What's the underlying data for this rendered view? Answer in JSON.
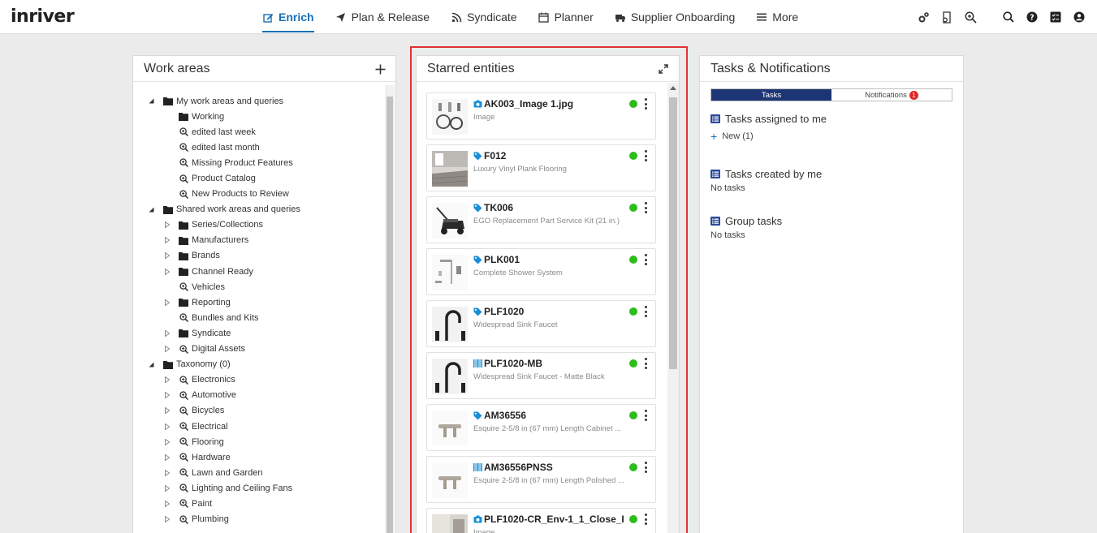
{
  "app": {
    "logo": "inriver"
  },
  "nav": [
    {
      "label": "Enrich",
      "icon": "edit-icon",
      "active": true
    },
    {
      "label": "Plan & Release",
      "icon": "paper-plane-icon",
      "active": false
    },
    {
      "label": "Syndicate",
      "icon": "rss-icon",
      "active": false
    },
    {
      "label": "Planner",
      "icon": "calendar-icon",
      "active": false
    },
    {
      "label": "Supplier Onboarding",
      "icon": "truck-icon",
      "active": false
    },
    {
      "label": "More",
      "icon": "hamburger-icon",
      "active": false
    }
  ],
  "toolbar_icons": [
    "settings-gears-icon",
    "workspace-icon",
    "zoom-in-icon",
    "search-icon",
    "help-icon",
    "checklist-icon",
    "user-icon"
  ],
  "work_areas": {
    "title": "Work areas",
    "items": [
      {
        "label": "My work areas and queries",
        "level": 0,
        "kind": "folder",
        "state": "expanded"
      },
      {
        "label": "Working",
        "level": 1,
        "kind": "folder",
        "state": "none"
      },
      {
        "label": "edited last week",
        "level": 1,
        "kind": "query",
        "state": "none"
      },
      {
        "label": "edited last month",
        "level": 1,
        "kind": "query",
        "state": "none"
      },
      {
        "label": "Missing Product Features",
        "level": 1,
        "kind": "query",
        "state": "none"
      },
      {
        "label": "Product Catalog",
        "level": 1,
        "kind": "query",
        "state": "none"
      },
      {
        "label": "New Products to Review",
        "level": 1,
        "kind": "query",
        "state": "none"
      },
      {
        "label": "Shared work areas and queries",
        "level": 0,
        "kind": "folder",
        "state": "expanded"
      },
      {
        "label": "Series/Collections",
        "level": 1,
        "kind": "folder",
        "state": "collapsed"
      },
      {
        "label": "Manufacturers",
        "level": 1,
        "kind": "folder",
        "state": "collapsed"
      },
      {
        "label": "Brands",
        "level": 1,
        "kind": "folder",
        "state": "collapsed"
      },
      {
        "label": "Channel Ready",
        "level": 1,
        "kind": "folder",
        "state": "collapsed"
      },
      {
        "label": "Vehicles",
        "level": 1,
        "kind": "query",
        "state": "none"
      },
      {
        "label": "Reporting",
        "level": 1,
        "kind": "folder",
        "state": "collapsed"
      },
      {
        "label": "Bundles and Kits",
        "level": 1,
        "kind": "query",
        "state": "none"
      },
      {
        "label": "Syndicate",
        "level": 1,
        "kind": "folder",
        "state": "collapsed"
      },
      {
        "label": "Digital Assets",
        "level": 1,
        "kind": "query",
        "state": "collapsed"
      },
      {
        "label": "Taxonomy (0)",
        "level": 0,
        "kind": "folder",
        "state": "expanded"
      },
      {
        "label": "Electronics",
        "level": 1,
        "kind": "query",
        "state": "collapsed"
      },
      {
        "label": "Automotive",
        "level": 1,
        "kind": "query",
        "state": "collapsed"
      },
      {
        "label": "Bicycles",
        "level": 1,
        "kind": "query",
        "state": "collapsed"
      },
      {
        "label": "Electrical",
        "level": 1,
        "kind": "query",
        "state": "collapsed"
      },
      {
        "label": "Flooring",
        "level": 1,
        "kind": "query",
        "state": "collapsed"
      },
      {
        "label": "Hardware",
        "level": 1,
        "kind": "query",
        "state": "collapsed"
      },
      {
        "label": "Lawn and Garden",
        "level": 1,
        "kind": "query",
        "state": "collapsed"
      },
      {
        "label": "Lighting and Ceiling Fans",
        "level": 1,
        "kind": "query",
        "state": "collapsed"
      },
      {
        "label": "Paint",
        "level": 1,
        "kind": "query",
        "state": "collapsed"
      },
      {
        "label": "Plumbing",
        "level": 1,
        "kind": "query",
        "state": "collapsed"
      }
    ]
  },
  "starred": {
    "title": "Starred entities",
    "items": [
      {
        "name": "AK003_Image 1.jpg",
        "subtitle": "Image",
        "type_icon": "camera-icon",
        "thumb": "hoses-image"
      },
      {
        "name": "F012",
        "subtitle": "Luxury Vinyl Plank Flooring",
        "type_icon": "tag-icon",
        "thumb": "room-image"
      },
      {
        "name": "TK006",
        "subtitle": "EGO Replacement Part Service Kit (21 in.)",
        "type_icon": "tag-icon",
        "thumb": "mower-image"
      },
      {
        "name": "PLK001",
        "subtitle": "Complete Shower System",
        "type_icon": "tag-icon",
        "thumb": "shower-image"
      },
      {
        "name": "PLF1020",
        "subtitle": "Widespread Sink Faucet",
        "type_icon": "tag-icon",
        "thumb": "faucet-image"
      },
      {
        "name": "PLF1020-MB",
        "subtitle": "Widespread Sink Faucet - Matte Black",
        "type_icon": "barcode-icon",
        "thumb": "faucet-image"
      },
      {
        "name": "AM36556",
        "subtitle": "Esquire 2-5/8 in (67 mm) Length Cabinet ...",
        "type_icon": "tag-icon",
        "thumb": "pull-image"
      },
      {
        "name": "AM36556PNSS",
        "subtitle": "Esquire 2-5/8 in (67 mm) Length Polished ...",
        "type_icon": "barcode-icon",
        "thumb": "pull-image"
      },
      {
        "name": "PLF1020-CR_Env-1_1_Close_H...",
        "subtitle": "Image",
        "type_icon": "camera-icon",
        "thumb": "bath-image"
      }
    ],
    "status_color": "#2ebd1c"
  },
  "tasks": {
    "title": "Tasks & Notifications",
    "tab_tasks": "Tasks",
    "tab_notifications": "Notifications",
    "notification_count": "1",
    "assigned_title": "Tasks assigned to me",
    "new_label": "New (1)",
    "created_title": "Tasks created by me",
    "created_empty": "No tasks",
    "group_title": "Group tasks",
    "group_empty": "No tasks"
  },
  "colors": {
    "accent": "#1a6fb5",
    "selected_tab": "#1e3575",
    "highlight_border": "#e03232"
  }
}
